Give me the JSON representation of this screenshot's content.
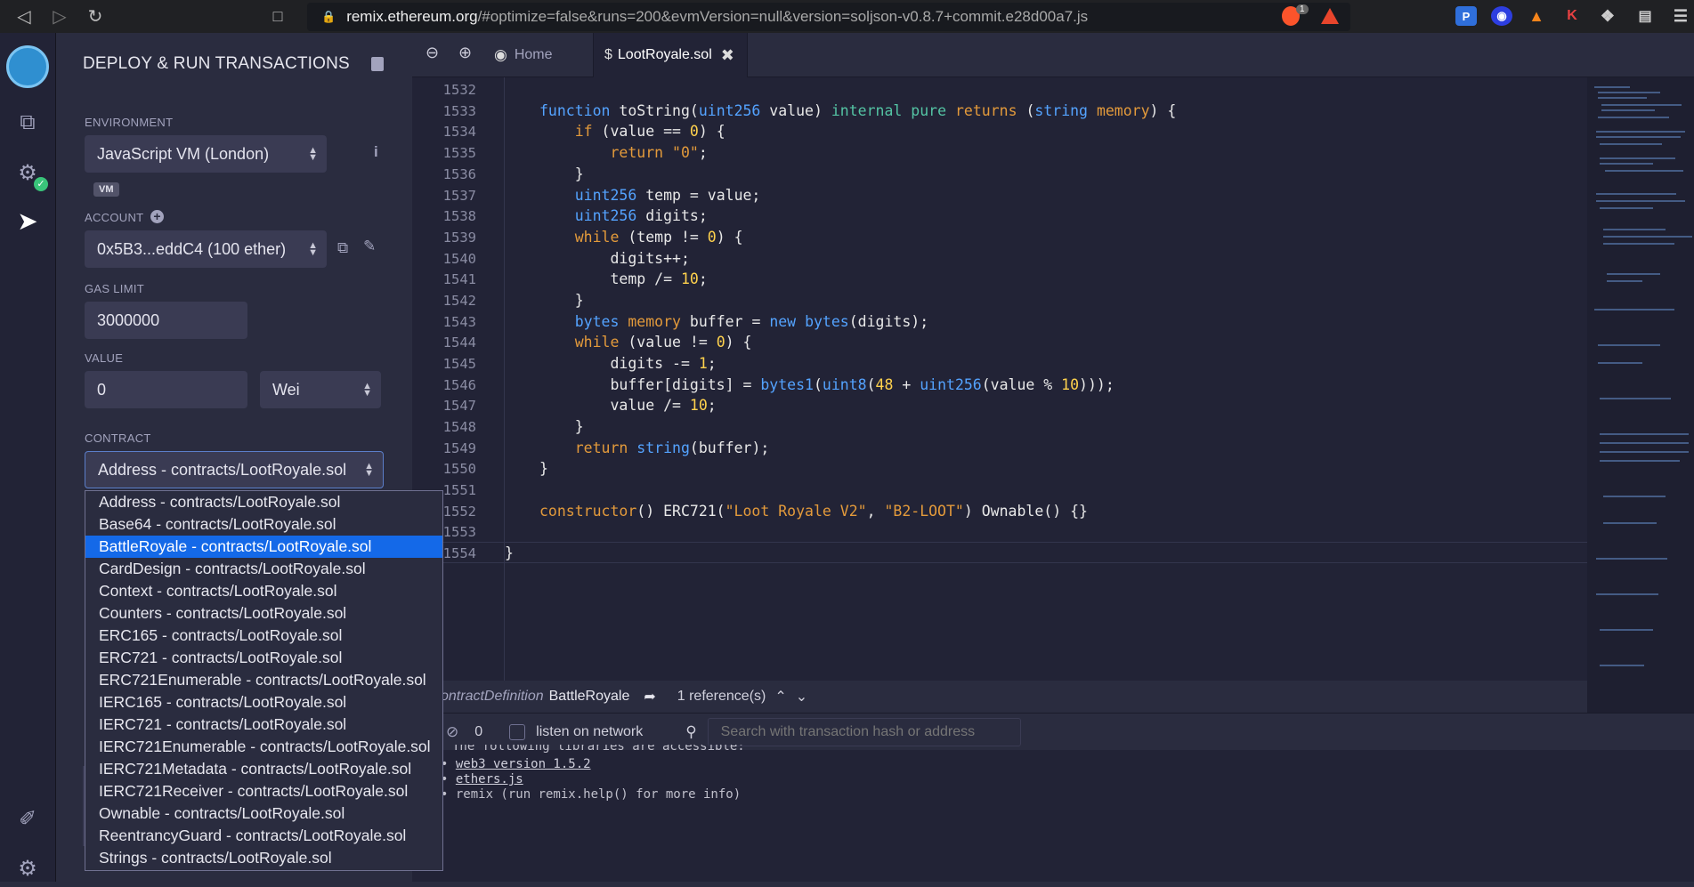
{
  "browser": {
    "url_domain": "remix.ethereum.org",
    "url_rest": "/#optimize=false&runs=200&evmVersion=null&version=soljson-v0.8.7+commit.e28d00a7.js",
    "brave_badge": "1"
  },
  "panel": {
    "title": "DEPLOY & RUN TRANSACTIONS",
    "environment_label": "ENVIRONMENT",
    "environment_value": "JavaScript VM (London)",
    "vm_badge": "VM",
    "account_label": "ACCOUNT",
    "account_value": "0x5B3...eddC4 (100 ether)",
    "gas_limit_label": "GAS LIMIT",
    "gas_limit_value": "3000000",
    "value_label": "VALUE",
    "value_amount": "0",
    "value_unit": "Wei",
    "contract_label": "CONTRACT",
    "contract_value": "Address - contracts/LootRoyale.sol"
  },
  "contract_options": [
    "Address - contracts/LootRoyale.sol",
    "Base64 - contracts/LootRoyale.sol",
    "BattleRoyale - contracts/LootRoyale.sol",
    "CardDesign - contracts/LootRoyale.sol",
    "Context - contracts/LootRoyale.sol",
    "Counters - contracts/LootRoyale.sol",
    "ERC165 - contracts/LootRoyale.sol",
    "ERC721 - contracts/LootRoyale.sol",
    "ERC721Enumerable - contracts/LootRoyale.sol",
    "IERC165 - contracts/LootRoyale.sol",
    "IERC721 - contracts/LootRoyale.sol",
    "IERC721Enumerable - contracts/LootRoyale.sol",
    "IERC721Metadata - contracts/LootRoyale.sol",
    "IERC721Receiver - contracts/LootRoyale.sol",
    "Ownable - contracts/LootRoyale.sol",
    "ReentrancyGuard - contracts/LootRoyale.sol",
    "Strings - contracts/LootRoyale.sol"
  ],
  "selected_option_index": 2,
  "tabs": {
    "home": "Home",
    "file": "LootRoyale.sol"
  },
  "line_numbers": [
    "1532",
    "1533",
    "1534",
    "1535",
    "1536",
    "1537",
    "1538",
    "1539",
    "1540",
    "1541",
    "1542",
    "1543",
    "1544",
    "1545",
    "1546",
    "1547",
    "1548",
    "1549",
    "1550",
    "1551",
    "1552",
    "1553",
    "1554"
  ],
  "refbar": {
    "definition_prefix": "ontractDefinition",
    "definition_name": "BattleRoyale",
    "references": "1 reference(s)"
  },
  "terminal": {
    "count": "0",
    "listen_label": "listen on network",
    "search_placeholder": "Search with transaction hash or address",
    "line0": "The following libraries are accessible:",
    "line1": "web3 version 1.5.2",
    "line2": "ethers.js",
    "line3": "remix (run remix.help() for more info)"
  },
  "colors": {
    "accent_blue": "#1469e8",
    "keyword": "#54a3ff",
    "string": "#e39a3b",
    "number": "#ffd24d"
  }
}
